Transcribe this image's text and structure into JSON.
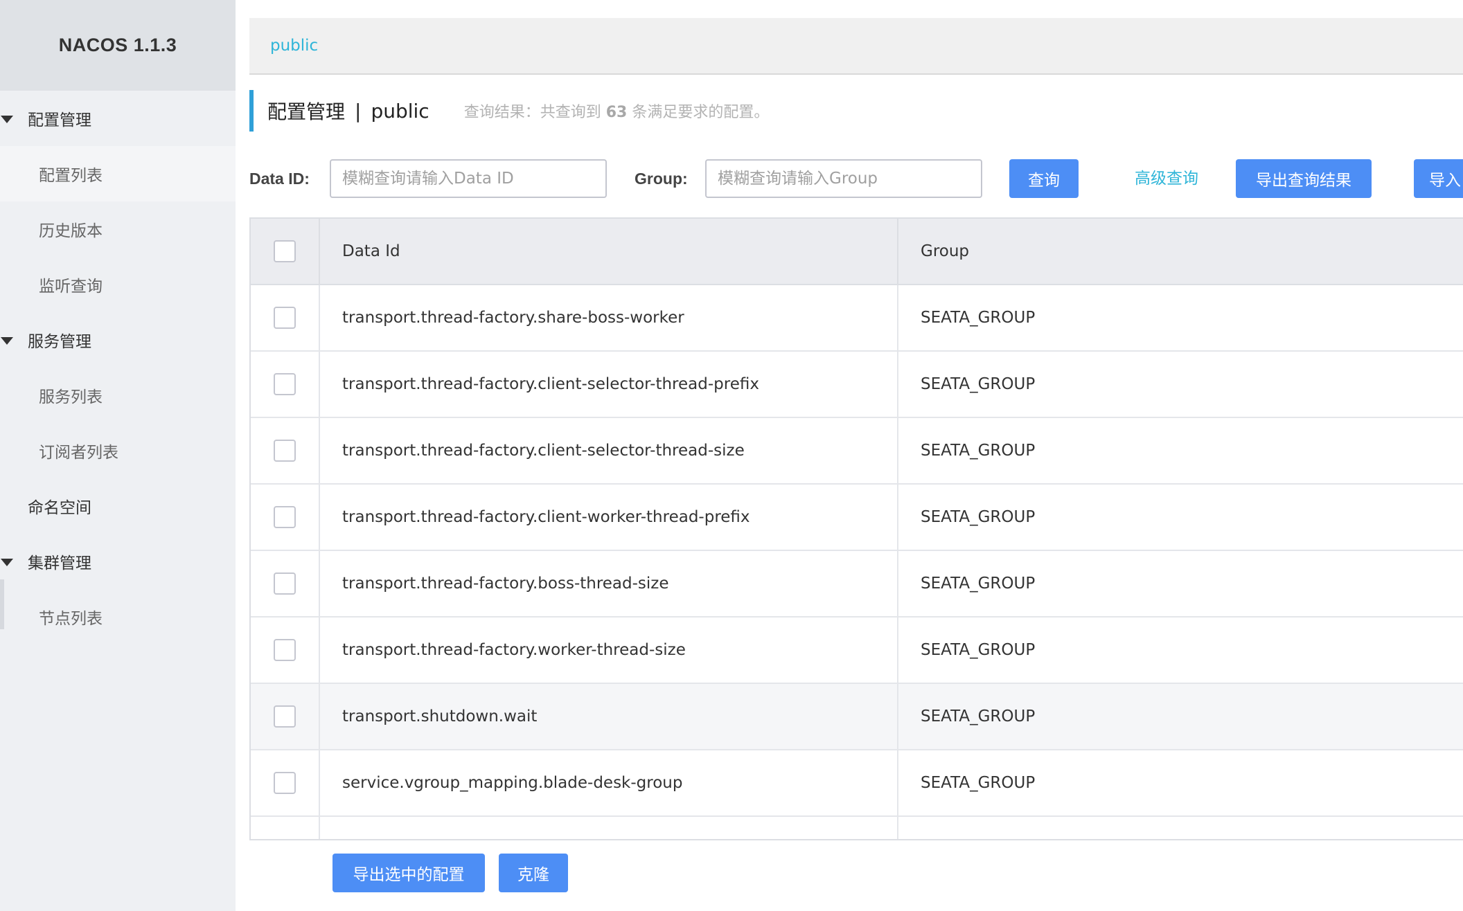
{
  "app": {
    "logo": "NACOS 1.1.3"
  },
  "sidebar": {
    "groups": [
      {
        "label": "配置管理",
        "items": [
          {
            "label": "配置列表"
          },
          {
            "label": "历史版本"
          },
          {
            "label": "监听查询"
          }
        ]
      },
      {
        "label": "服务管理",
        "items": [
          {
            "label": "服务列表"
          },
          {
            "label": "订阅者列表"
          }
        ]
      },
      {
        "label": "命名空间"
      },
      {
        "label": "集群管理",
        "items": [
          {
            "label": "节点列表"
          }
        ]
      }
    ]
  },
  "namespace_bar": {
    "current": "public"
  },
  "page": {
    "title": "配置管理",
    "separator": "|",
    "namespace": "public",
    "result_prefix": "查询结果：共查询到",
    "result_count": "63",
    "result_suffix": "条满足要求的配置。"
  },
  "search": {
    "data_id_label": "Data ID:",
    "data_id_placeholder": "模糊查询请输入Data ID",
    "group_label": "Group:",
    "group_placeholder": "模糊查询请输入Group",
    "query_button": "查询",
    "advanced_link": "高级查询",
    "export_results_button": "导出查询结果",
    "import_button": "导入"
  },
  "table": {
    "columns": [
      "Data Id",
      "Group"
    ],
    "rows": [
      {
        "data_id": "transport.thread-factory.share-boss-worker",
        "group": "SEATA_GROUP"
      },
      {
        "data_id": "transport.thread-factory.client-selector-thread-prefix",
        "group": "SEATA_GROUP"
      },
      {
        "data_id": "transport.thread-factory.client-selector-thread-size",
        "group": "SEATA_GROUP"
      },
      {
        "data_id": "transport.thread-factory.client-worker-thread-prefix",
        "group": "SEATA_GROUP"
      },
      {
        "data_id": "transport.thread-factory.boss-thread-size",
        "group": "SEATA_GROUP"
      },
      {
        "data_id": "transport.thread-factory.worker-thread-size",
        "group": "SEATA_GROUP"
      },
      {
        "data_id": "transport.shutdown.wait",
        "group": "SEATA_GROUP"
      },
      {
        "data_id": "service.vgroup_mapping.blade-desk-group",
        "group": "SEATA_GROUP"
      }
    ]
  },
  "footer_actions": {
    "export_selected": "导出选中的配置",
    "clone": "克隆"
  },
  "colors": {
    "primary": "#4d8ef5",
    "link": "#2fb5d8",
    "accent_bar": "#2fa0d8",
    "sidebar_bg": "#eef0f3"
  }
}
